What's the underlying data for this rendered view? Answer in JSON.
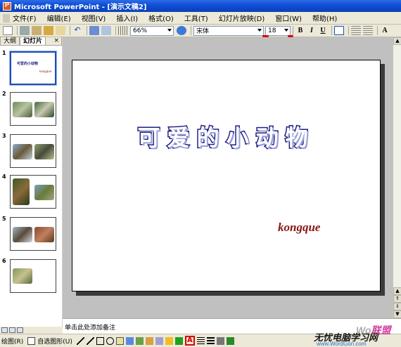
{
  "window": {
    "title": "Microsoft PowerPoint - [演示文稿2]"
  },
  "menu": {
    "items": [
      "文件(F)",
      "编辑(E)",
      "视图(V)",
      "插入(I)",
      "格式(O)",
      "工具(T)",
      "幻灯片放映(D)",
      "窗口(W)",
      "帮助(H)"
    ]
  },
  "toolbar": {
    "zoom": "66%",
    "font": "宋体",
    "size": "18",
    "bold": "B",
    "italic": "I",
    "underline": "U",
    "grow_font": "A"
  },
  "left_pane": {
    "tabs": [
      "大纲",
      "幻灯片"
    ],
    "active_tab": "幻灯片",
    "close": "×",
    "slides": [
      {
        "num": "1",
        "title": "可爱的小动物",
        "sub": "kongque"
      },
      {
        "num": "2"
      },
      {
        "num": "3"
      },
      {
        "num": "4"
      },
      {
        "num": "5"
      },
      {
        "num": "6"
      }
    ]
  },
  "slide": {
    "title": "可爱的小动物",
    "subtitle": "kongque"
  },
  "notes": {
    "placeholder": "单击此处添加备注"
  },
  "drawbar": {
    "draw_label": "绘图(R)",
    "autoshapes_label": "自选图形(U)"
  },
  "watermark": {
    "brand_a": "Wo",
    "brand_b": "联盟",
    "cn": "无忧电脑学习网",
    "url": "www.WordGon.com"
  },
  "colors": {
    "title_stroke": "#1c1f86",
    "subtitle": "#8a1414",
    "titlebar": "#1050d8",
    "highlight": "#e00000"
  }
}
